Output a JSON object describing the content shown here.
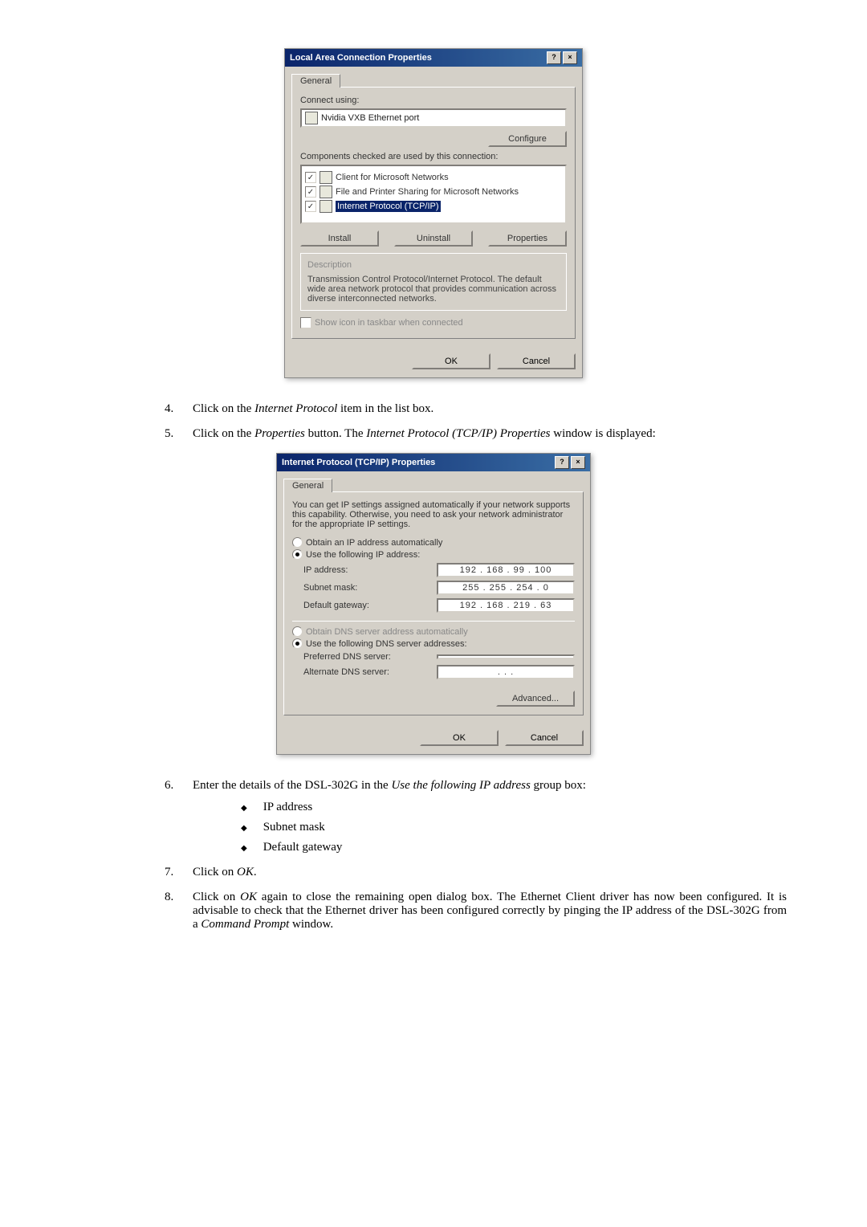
{
  "dialog1": {
    "title": "Local Area Connection Properties",
    "help_btn": "?",
    "close_btn": "×",
    "tab": "General",
    "connect_using_label": "Connect using:",
    "adapter": "Nvidia VXB Ethernet port",
    "configure_btn": "Configure",
    "components_label": "Components checked are used by this connection:",
    "items": [
      "Client for Microsoft Networks",
      "File and Printer Sharing for Microsoft Networks",
      "Internet Protocol (TCP/IP)"
    ],
    "install_btn": "Install",
    "uninstall_btn": "Uninstall",
    "properties_btn": "Properties",
    "description_label": "Description",
    "description_text": "Transmission Control Protocol/Internet Protocol. The default wide area network protocol that provides communication across diverse interconnected networks.",
    "show_icon": "Show icon in taskbar when connected",
    "ok": "OK",
    "cancel": "Cancel"
  },
  "step4": {
    "pre": "Click on the ",
    "ital": "Internet Protocol",
    "post": " item in the list box."
  },
  "step5": {
    "pre": "Click on the ",
    "ital1": "Properties",
    "mid": " button. The ",
    "ital2": "Internet Protocol (TCP/IP) Properties",
    "post": " window is displayed:"
  },
  "dialog2": {
    "title": "Internet Protocol (TCP/IP) Properties",
    "help_btn": "?",
    "close_btn": "×",
    "tab": "General",
    "intro": "You can get IP settings assigned automatically if your network supports this capability. Otherwise, you need to ask your network administrator for the appropriate IP settings.",
    "radio_auto": "Obtain an IP address automatically",
    "radio_manual": "Use the following IP address:",
    "ip_label": "IP address:",
    "ip_value": "192 . 168 . 99 . 100",
    "subnet_label": "Subnet mask:",
    "subnet_value": "255 . 255 . 254 .  0",
    "gateway_label": "Default gateway:",
    "gateway_value": "192 . 168 . 219 . 63",
    "dns_auto": "Obtain DNS server address automatically",
    "dns_manual": "Use the following DNS server addresses:",
    "pref_dns_label": "Preferred DNS server:",
    "pref_dns_value": "",
    "alt_dns_label": "Alternate DNS server:",
    "alt_dns_value": ".     .     .",
    "advanced_btn": "Advanced...",
    "ok": "OK",
    "cancel": "Cancel"
  },
  "step6": {
    "pre": "Enter the details of the DSL-302G in the ",
    "ital": "Use the following IP address",
    "post": " group box:"
  },
  "bullets": {
    "b1": "IP address",
    "b2": "Subnet mask",
    "b3": "Default gateway"
  },
  "step7": {
    "pre": "Click on ",
    "ital": "OK",
    "post": "."
  },
  "step8": {
    "p1a": "Click on ",
    "p1_ital": "OK",
    "p1b": " again to close the remaining open dialog box. The Ethernet Client driver has now been configured. It is advisable to check that the Ethernet driver has been configured correctly by pinging the IP address of the DSL-302G from a ",
    "p1_ital2": "Command Prompt",
    "p1c": " window."
  }
}
